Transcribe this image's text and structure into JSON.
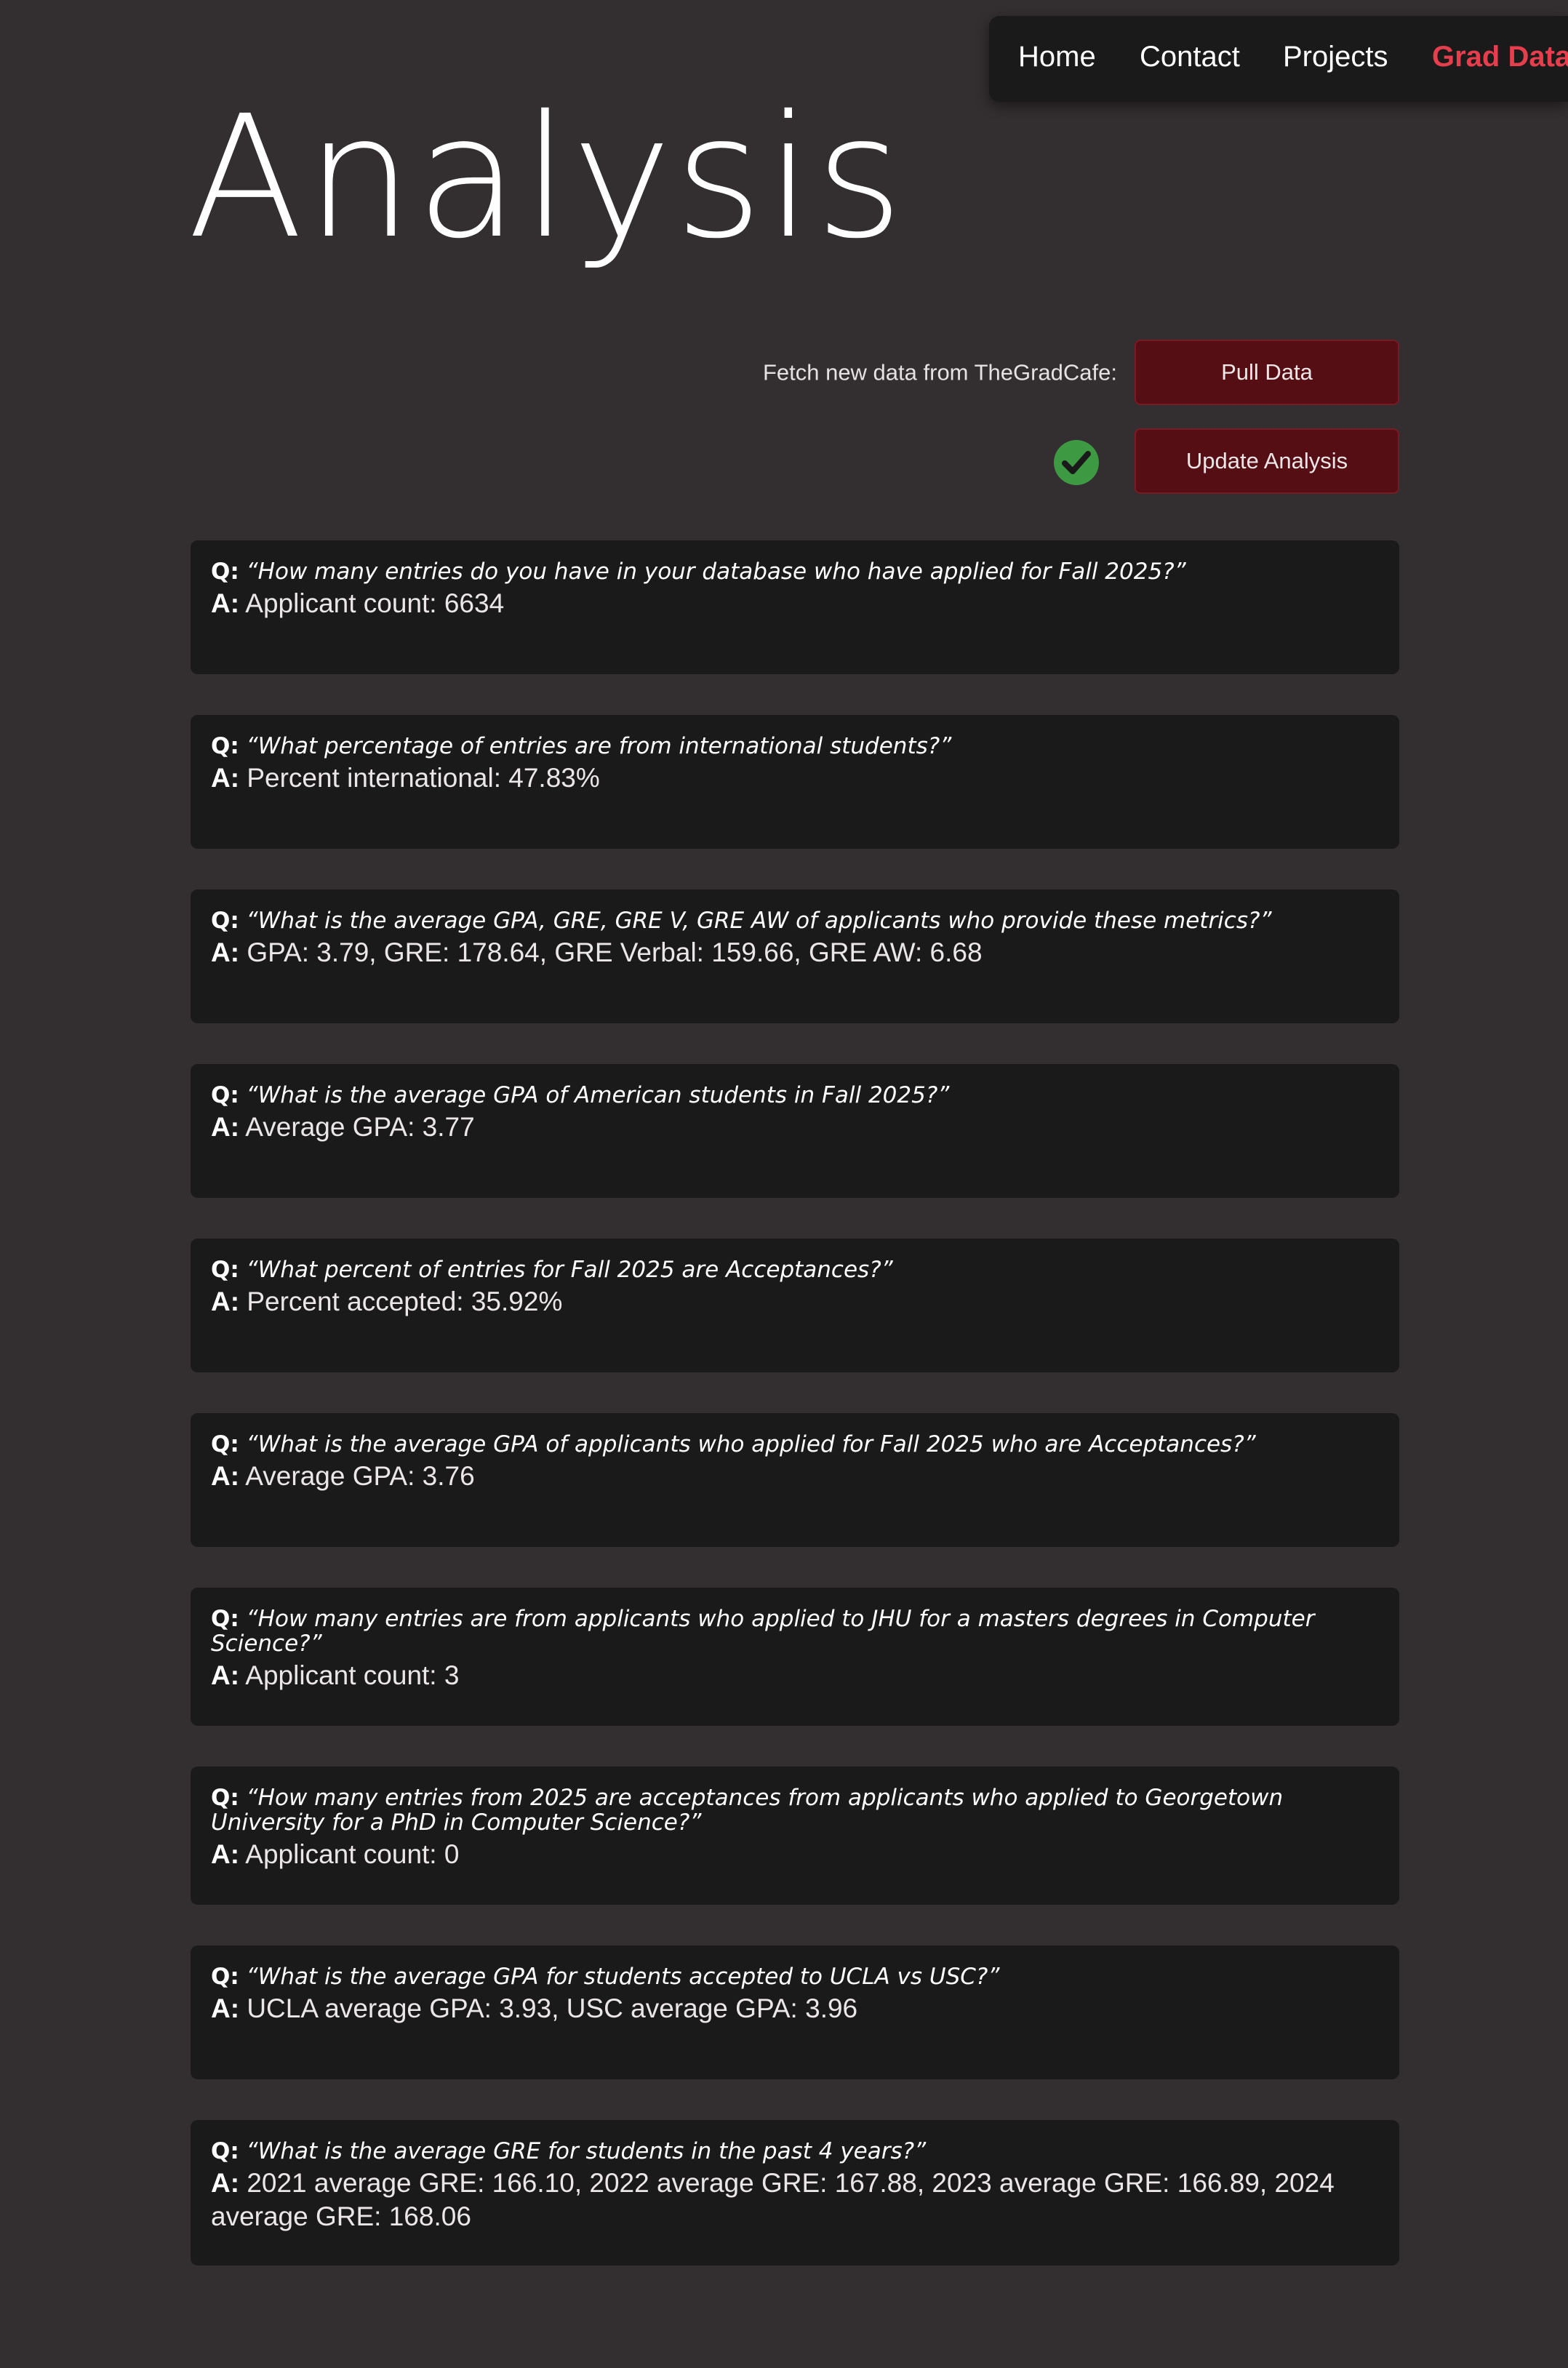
{
  "nav": {
    "home": "Home",
    "contact": "Contact",
    "projects": "Projects",
    "grad_data": "Grad Data"
  },
  "page_title": "Analysis",
  "controls": {
    "fetch_label": "Fetch new data from TheGradCafe:",
    "pull_button": "Pull Data",
    "update_button": "Update Analysis",
    "status_icon": "check-circle-icon"
  },
  "colors": {
    "background": "#332e2f",
    "card": "#1b1a1b",
    "accent": "#e63e4d",
    "button": "#560e15",
    "success": "#3d9a43"
  },
  "qa_prefix": {
    "q": "Q:",
    "a": "A:"
  },
  "qa": [
    {
      "question": "“How many entries do you have in your database who have applied for Fall 2025?”",
      "answer": "Applicant count: 6634"
    },
    {
      "question": "“What percentage of entries are from international students?”",
      "answer": "Percent international: 47.83%"
    },
    {
      "question": "“What is the average GPA, GRE, GRE V, GRE AW of applicants who provide these metrics?”",
      "answer": "GPA: 3.79, GRE: 178.64, GRE Verbal: 159.66, GRE AW: 6.68"
    },
    {
      "question": "“What is the average GPA of American students in Fall 2025?”",
      "answer": "Average GPA: 3.77"
    },
    {
      "question": "“What percent of entries for Fall 2025 are Acceptances?”",
      "answer": "Percent accepted: 35.92%"
    },
    {
      "question": "“What is the average GPA of applicants who applied for Fall 2025 who are Acceptances?”",
      "answer": "Average GPA: 3.76"
    },
    {
      "question": "“How many entries are from applicants who applied to JHU for a masters degrees in Computer Science?”",
      "answer": "Applicant count: 3"
    },
    {
      "question": "“How many entries from 2025 are acceptances from applicants who applied to Georgetown University for a PhD in Computer Science?”",
      "answer": "Applicant count: 0"
    },
    {
      "question": "“What is the average GPA for students accepted to UCLA vs USC?”",
      "answer": "UCLA average GPA: 3.93, USC average GPA: 3.96"
    },
    {
      "question": "“What is the average GRE for students in the past 4 years?”",
      "answer": "2021 average GRE: 166.10, 2022 average GRE: 167.88, 2023 average GRE: 166.89, 2024 average GRE: 168.06"
    }
  ]
}
